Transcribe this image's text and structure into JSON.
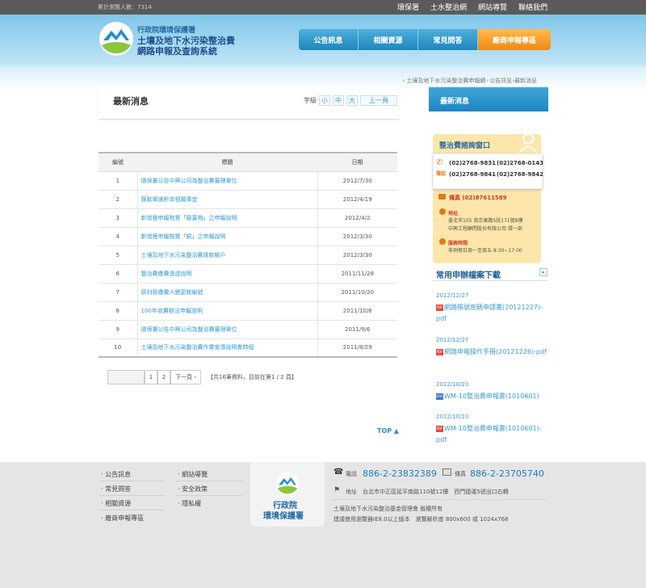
{
  "topbar": {
    "counter": "累計瀏覽人數：7314",
    "links": [
      "環保署",
      "土水整治網",
      "網站導覽",
      "聯絡我們"
    ]
  },
  "header": {
    "org": "行政院環境保護署",
    "title_line1": "土壤及地下水污染整治費",
    "title_line2": "網路申報及查詢系統"
  },
  "nav": [
    "公告訊息",
    "相關資源",
    "常見問答",
    "廠商申報專區"
  ],
  "breadcrumb": [
    "土壤及地下水污染整治費申報網",
    "公告訊息",
    "最新消息"
  ],
  "page": {
    "title": "最新消息",
    "font_label": "字級",
    "font_small": "小",
    "font_medium": "中",
    "font_large": "大",
    "back": "上一頁"
  },
  "table": {
    "headers": [
      "編號",
      "標題",
      "日期"
    ],
    "rows": [
      {
        "no": "1",
        "title": "環保署公告中興公司為整治費審理單位",
        "date": "2012/7/30"
      },
      {
        "no": "2",
        "title": "匯款單據影本相關事宜",
        "date": "2012/4/19"
      },
      {
        "no": "3",
        "title": "新增應申報物質「廢棄物」之申報說明",
        "date": "2012/4/2"
      },
      {
        "no": "4",
        "title": "新增應申報物質「銅」之申報說明",
        "date": "2012/3/30"
      },
      {
        "no": "5",
        "title": "土壤及地下水污染整治費匯款帳戶",
        "date": "2012/3/30"
      },
      {
        "no": "6",
        "title": "整治費繳費憑證說明",
        "date": "2011/11/28"
      },
      {
        "no": "7",
        "title": "原列管繳費人變更統編號",
        "date": "2011/10/20"
      },
      {
        "no": "8",
        "title": "100年收費辦法申報說明",
        "date": "2011/10/6"
      },
      {
        "no": "9",
        "title": "環保署公告中興公司為整治費審理單位",
        "date": "2011/9/6"
      },
      {
        "no": "10",
        "title": "土壤及地下水污染整治費作業宣導說明會時程",
        "date": "2011/8/29"
      }
    ]
  },
  "pager": {
    "pages": [
      "1",
      "2"
    ],
    "next": "下一頁",
    "info": "【共16筆資料，目前在第1 / 2 頁】"
  },
  "top_link": "TOP",
  "sidebar": {
    "heading": "最新消息",
    "contact": {
      "title": "整治費諮詢窗口",
      "phone_label": "電話",
      "phones": [
        "(02)2768-9831",
        "(02)2768-0143",
        "(02)2768-9841",
        "(02)2768-9842"
      ],
      "fax": "傳真  (02)87611589",
      "address_label": "地址",
      "address_line1": "臺北市105 南京東路5段171號8樓",
      "address_line2": "中興工程顧問股份有限公司 環一部",
      "hours_label": "服務時間",
      "hours": "非例假日周一至周五 8:30~17:00"
    },
    "downloads_title": "常用申辦檔案下載",
    "downloads": [
      {
        "date": "2012/12/27",
        "name": "網路帳號密碼申請書(20121227)-pdf",
        "type": "pdf"
      },
      {
        "date": "2012/12/27",
        "name": "網路申報操作手冊(20121226)-pdf",
        "type": "pdf"
      },
      {
        "date": "2012/10/23",
        "name": "WM-10整治費申報書(1010601)",
        "type": "doc"
      },
      {
        "date": "2012/10/23",
        "name": "WM-10整治費申報書(1010601)-pdf",
        "type": "pdf"
      }
    ]
  },
  "footer": {
    "col1": [
      "公告訊息",
      "常見問答",
      "相關資源",
      "廠商申報專區"
    ],
    "col2": [
      "網站導覽",
      "安全政策",
      "隱私權"
    ],
    "org_line1": "行政院",
    "org_line2": "環境保護署",
    "phone_label": "電話",
    "phone": "886-2-23832389",
    "fax_label": "傳真",
    "fax": "886-2-23705740",
    "address_label": "地址",
    "address": "台北市中正區延平南路110號12樓　西門捷運5號出口右轉",
    "copyright": "土壤及地下水污染整治基金管理會  版權所有",
    "browser": "建議使用瀏覽器IE8.0以上版本　瀏覽解析度 800x600 或 1024x768"
  }
}
